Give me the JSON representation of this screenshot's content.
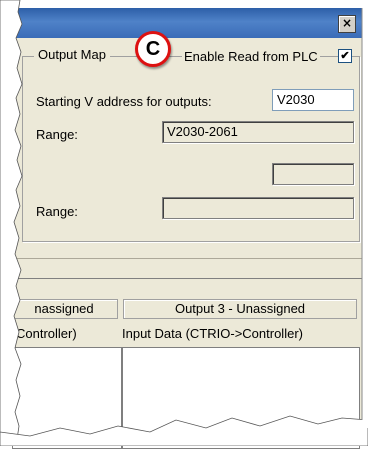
{
  "titlebar": {
    "close_label": "×"
  },
  "badge": {
    "label": "C"
  },
  "output_map": {
    "title": "Output Map",
    "enable_label": "Enable Read from PLC",
    "enable_checked": "✔",
    "starting_label": "Starting V address for outputs:",
    "starting_value": "V2030",
    "range_label_1": "Range:",
    "range_value_1": "V2030-2061",
    "range_label_2": "Range:",
    "range_value_2": "",
    "blank_value": ""
  },
  "table": {
    "headers": [
      "nassigned",
      "Output 3 - Unassigned"
    ],
    "subheaders": [
      "Controller)",
      "Input Data (CTRIO->Controller)"
    ]
  }
}
